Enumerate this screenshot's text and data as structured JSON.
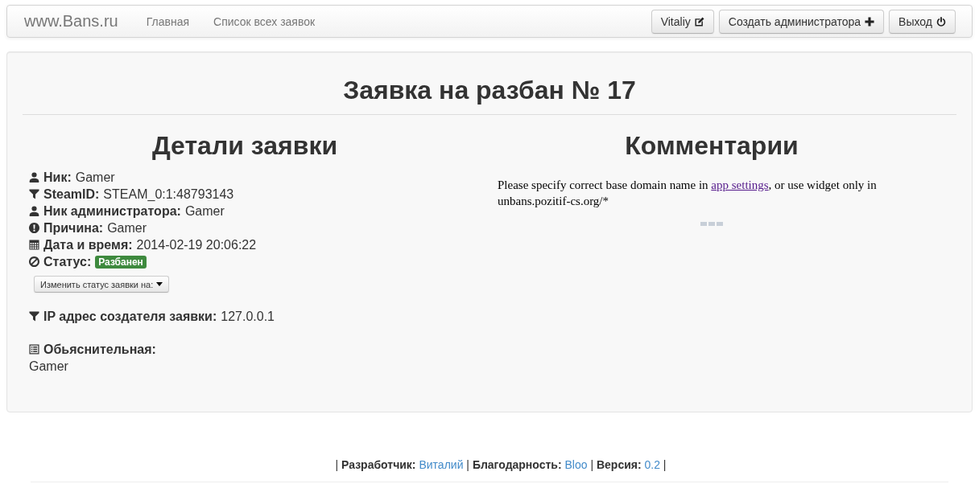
{
  "navbar": {
    "brand": "www.Bans.ru",
    "links": [
      {
        "label": "Главная",
        "selected": false
      },
      {
        "label": "Список всех заявок",
        "selected": false
      }
    ],
    "buttons": [
      {
        "label": "Vitaliy",
        "kind": "edit"
      },
      {
        "label": "Создать администратора",
        "kind": "add"
      },
      {
        "label": "Выход",
        "kind": "logout"
      }
    ]
  },
  "title": "Заявка на разбан № 17",
  "details": {
    "heading": "Детали заявки",
    "fields": [
      {
        "kind": "player",
        "label": "Ник:",
        "value": "Gamer"
      },
      {
        "kind": "steam",
        "label": "SteamID:",
        "value": "STEAM_0:1:48793143"
      },
      {
        "kind": "admin",
        "label": "Ник администратора:",
        "value": "Gamer"
      },
      {
        "kind": "reason",
        "label": "Причина:",
        "value": "Gamer"
      },
      {
        "kind": "date",
        "label": "Дата и время:",
        "value": "2014-02-19 20:06:22"
      },
      {
        "kind": "status",
        "label": "Статус:",
        "badge": "Разбанен"
      }
    ],
    "status_menu": "Изменить статус заявки на:",
    "ip": {
      "kind": "ip",
      "label": "IP адрес создателя заявки:",
      "value": "127.0.0.1"
    },
    "explanation": {
      "kind": "explanation",
      "label": "Обьяснительная:",
      "value": "Gamer"
    }
  },
  "comments": {
    "heading": "Комментарии",
    "notice": {
      "before": "Please specify correct base domain name in",
      "link": "app settings",
      "after": ", or use widget only in unbans.pozitif-cs.org/*"
    }
  },
  "footer": {
    "separator": "|",
    "credits": [
      {
        "label": "Разработчик:",
        "value": "Виталий"
      },
      {
        "label": "Благодарность:",
        "value": "Bloo"
      },
      {
        "label": "Версия:",
        "value": "0.2"
      }
    ]
  }
}
